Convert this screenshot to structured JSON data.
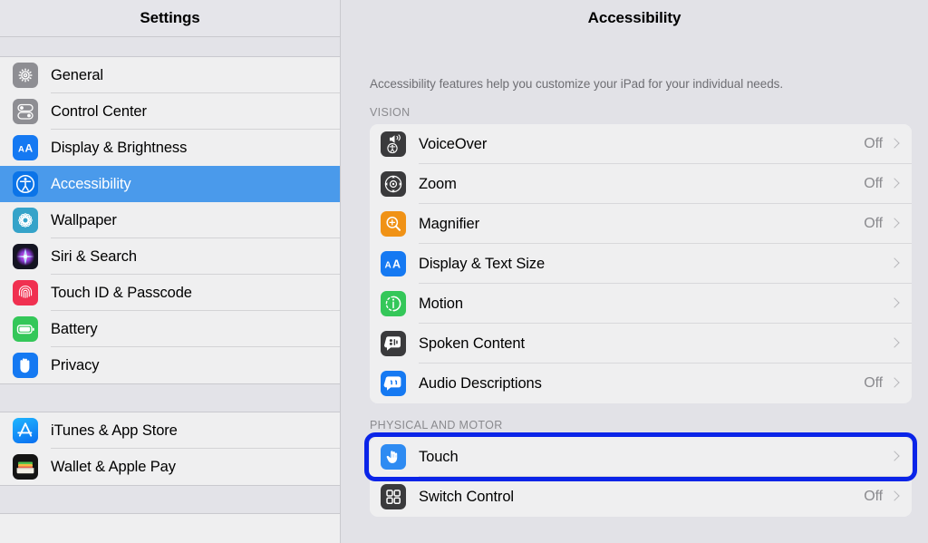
{
  "sidebar": {
    "title": "Settings",
    "groups": [
      {
        "items": [
          {
            "label": "General",
            "icon": "gear-icon",
            "selected": false
          },
          {
            "label": "Control Center",
            "icon": "control-center-icon",
            "selected": false
          },
          {
            "label": "Display & Brightness",
            "icon": "display-brightness-icon",
            "selected": false
          },
          {
            "label": "Accessibility",
            "icon": "accessibility-icon",
            "selected": true
          },
          {
            "label": "Wallpaper",
            "icon": "wallpaper-icon",
            "selected": false
          },
          {
            "label": "Siri & Search",
            "icon": "siri-icon",
            "selected": false
          },
          {
            "label": "Touch ID & Passcode",
            "icon": "touch-id-icon",
            "selected": false
          },
          {
            "label": "Battery",
            "icon": "battery-icon",
            "selected": false
          },
          {
            "label": "Privacy",
            "icon": "privacy-hand-icon",
            "selected": false
          }
        ]
      },
      {
        "items": [
          {
            "label": "iTunes & App Store",
            "icon": "app-store-icon",
            "selected": false
          },
          {
            "label": "Wallet & Apple Pay",
            "icon": "wallet-icon",
            "selected": false
          }
        ]
      }
    ]
  },
  "detail": {
    "title": "Accessibility",
    "description": "Accessibility features help you customize your iPad for your individual needs.",
    "sections": [
      {
        "header": "VISION",
        "rows": [
          {
            "label": "VoiceOver",
            "value": "Off",
            "icon": "voiceover-icon",
            "chevron": true
          },
          {
            "label": "Zoom",
            "value": "Off",
            "icon": "zoom-icon",
            "chevron": true
          },
          {
            "label": "Magnifier",
            "value": "Off",
            "icon": "magnifier-icon",
            "chevron": true
          },
          {
            "label": "Display & Text Size",
            "value": "",
            "icon": "text-size-icon",
            "chevron": true
          },
          {
            "label": "Motion",
            "value": "",
            "icon": "motion-icon",
            "chevron": true
          },
          {
            "label": "Spoken Content",
            "value": "",
            "icon": "spoken-content-icon",
            "chevron": true
          },
          {
            "label": "Audio Descriptions",
            "value": "Off",
            "icon": "audio-descriptions-icon",
            "chevron": true
          }
        ]
      },
      {
        "header": "PHYSICAL AND MOTOR",
        "rows": [
          {
            "label": "Touch",
            "value": "",
            "icon": "touch-icon",
            "chevron": true,
            "highlighted": true
          },
          {
            "label": "Switch Control",
            "value": "Off",
            "icon": "switch-control-icon",
            "chevron": true
          }
        ]
      }
    ]
  },
  "annotation": {
    "target": "Touch",
    "color": "#0a24e8"
  },
  "colors": {
    "selection_blue": "#4a9aeb",
    "panel_background": "#e2e2e7",
    "row_background": "#efeff0",
    "secondary_text": "#8a8a8e",
    "annotation_blue": "#0a24e8"
  }
}
